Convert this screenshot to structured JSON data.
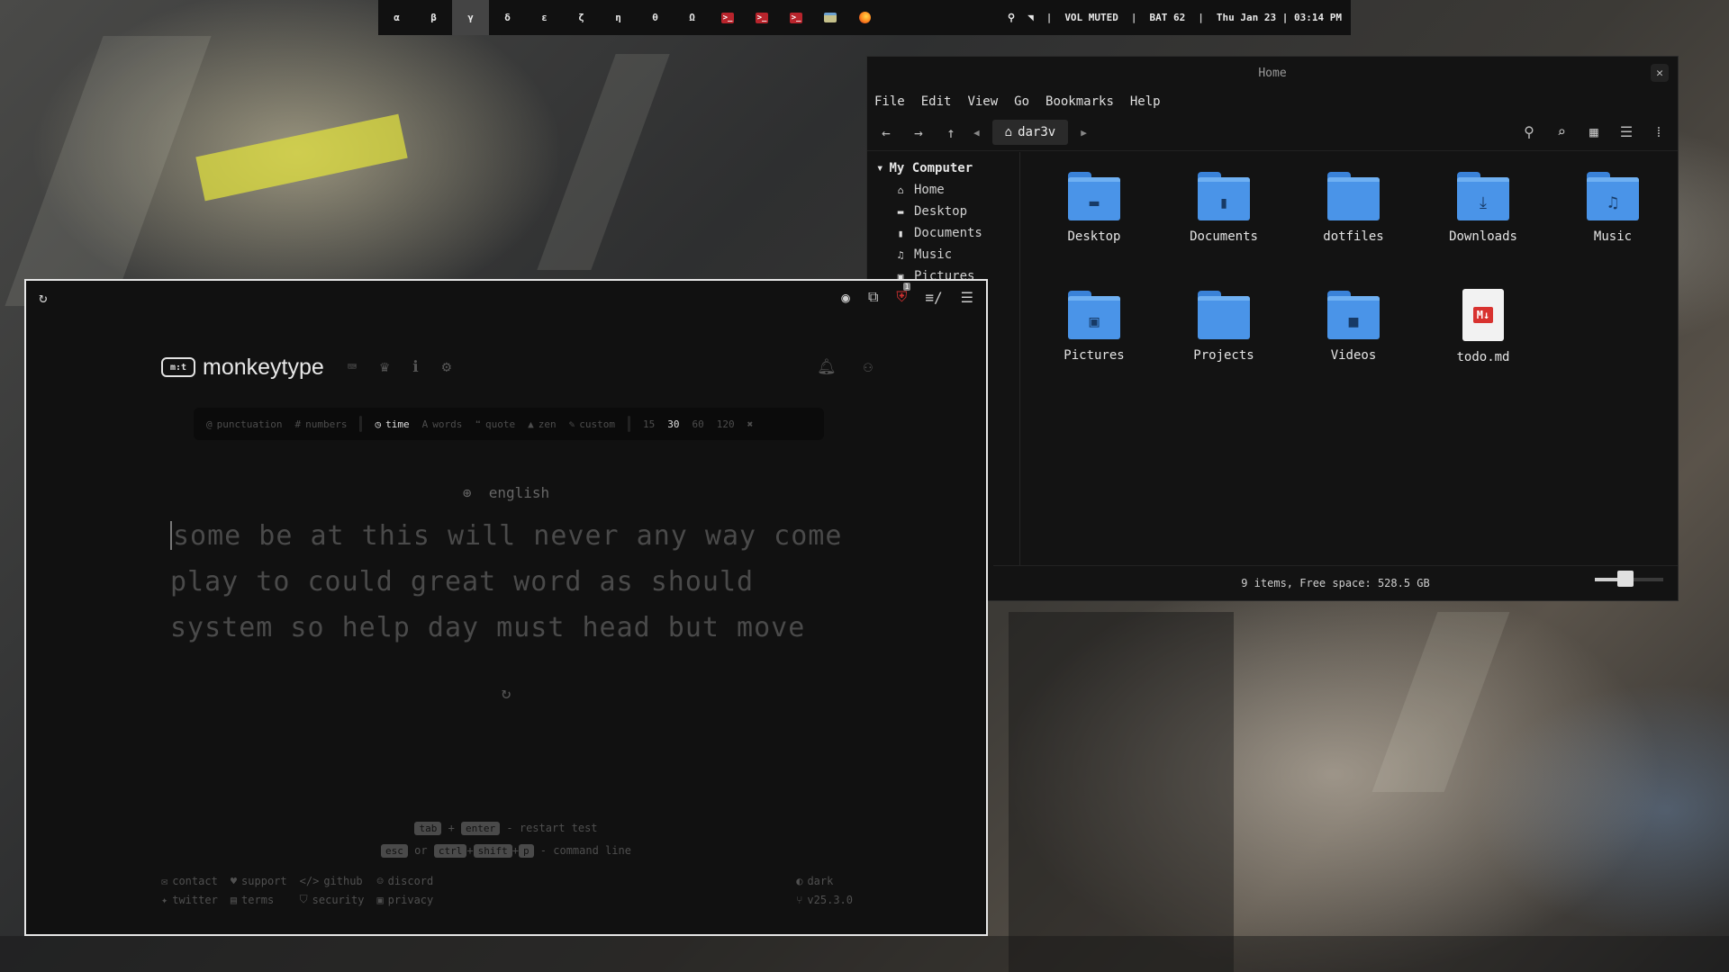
{
  "topbar": {
    "workspaces": [
      "α",
      "β",
      "γ",
      "δ",
      "ε",
      "ζ",
      "η",
      "θ",
      "Ω"
    ],
    "active_workspace": "γ",
    "apps": [
      {
        "icon": "terminal-icon",
        "glyph": ">_"
      },
      {
        "icon": "terminal-icon",
        "glyph": ">_"
      },
      {
        "icon": "terminal-icon",
        "glyph": ">_"
      },
      {
        "icon": "file-manager-icon",
        "glyph": ""
      },
      {
        "icon": "firefox-icon",
        "glyph": ""
      }
    ],
    "volume": "VOL MUTED",
    "battery": "BAT 62",
    "datetime": "Thu Jan 23 | 03:14 PM",
    "separator": "|"
  },
  "file_manager": {
    "title": "Home",
    "close_glyph": "✕",
    "menu": [
      "File",
      "Edit",
      "View",
      "Go",
      "Bookmarks",
      "Help"
    ],
    "path": "dar3v",
    "sidebar": {
      "heading": "My Computer",
      "items": [
        {
          "label": "Home",
          "icon": "home-icon",
          "glyph": "⌂"
        },
        {
          "label": "Desktop",
          "icon": "desktop-icon",
          "glyph": "▬"
        },
        {
          "label": "Documents",
          "icon": "document-icon",
          "glyph": "▮"
        },
        {
          "label": "Music",
          "icon": "music-icon",
          "glyph": "♫"
        },
        {
          "label": "Pictures",
          "icon": "pictures-icon",
          "glyph": "▣"
        }
      ]
    },
    "items": [
      {
        "name": "Desktop",
        "type": "folder",
        "glyph": "▬"
      },
      {
        "name": "Documents",
        "type": "folder",
        "glyph": "▮"
      },
      {
        "name": "dotfiles",
        "type": "folder",
        "glyph": ""
      },
      {
        "name": "Downloads",
        "type": "folder",
        "glyph": "⤓"
      },
      {
        "name": "Music",
        "type": "folder",
        "glyph": "♫"
      },
      {
        "name": "Pictures",
        "type": "folder",
        "glyph": "▣"
      },
      {
        "name": "Projects",
        "type": "folder",
        "glyph": ""
      },
      {
        "name": "Videos",
        "type": "folder",
        "glyph": "■"
      },
      {
        "name": "todo.md",
        "type": "markdown",
        "badge": "M↓"
      }
    ],
    "status": "9 items, Free space: 528.5 GB",
    "zoom_level": 0.45,
    "accent": "#4a94e8"
  },
  "monkeytype": {
    "brand": "monkeytype",
    "logo_glyph": "m:t",
    "extension_badge": "1",
    "config": {
      "left": [
        {
          "label": "punctuation",
          "glyph": "@",
          "active": false
        },
        {
          "label": "numbers",
          "glyph": "#",
          "active": false
        }
      ],
      "modes": [
        {
          "label": "time",
          "glyph": "◷",
          "active": true
        },
        {
          "label": "words",
          "glyph": "A",
          "active": false
        },
        {
          "label": "quote",
          "glyph": "❝",
          "active": false
        },
        {
          "label": "zen",
          "glyph": "▲",
          "active": false
        },
        {
          "label": "custom",
          "glyph": "✎",
          "active": false
        }
      ],
      "durations": [
        {
          "label": "15",
          "active": false
        },
        {
          "label": "30",
          "active": true
        },
        {
          "label": "60",
          "active": false
        },
        {
          "label": "120",
          "active": false
        }
      ],
      "custom_glyph": "✖"
    },
    "language": "english",
    "words": [
      "some be at this will never any way come",
      "play to could great word as should",
      "system so help day must head but move"
    ],
    "restart_glyph": "↻",
    "hints": {
      "tab": "tab",
      "plus": "+",
      "enter": "enter",
      "restart": "- restart test",
      "esc": "esc",
      "or": "or",
      "ctrl": "ctrl",
      "shift": "shift",
      "p": "p",
      "command": "- command line"
    },
    "footer": {
      "links": [
        {
          "label": "contact",
          "icon": "mail-icon",
          "glyph": "✉"
        },
        {
          "label": "support",
          "icon": "donate-icon",
          "glyph": "♥"
        },
        {
          "label": "github",
          "icon": "code-icon",
          "glyph": "</>"
        },
        {
          "label": "discord",
          "icon": "discord-icon",
          "glyph": "☺"
        },
        {
          "label": "twitter",
          "icon": "twitter-icon",
          "glyph": "✦"
        },
        {
          "label": "terms",
          "icon": "terms-icon",
          "glyph": "▤"
        },
        {
          "label": "security",
          "icon": "shield-icon",
          "glyph": "⛉"
        },
        {
          "label": "privacy",
          "icon": "lock-icon",
          "glyph": "▣"
        }
      ],
      "theme": "dark",
      "version": "v25.3.0"
    }
  }
}
